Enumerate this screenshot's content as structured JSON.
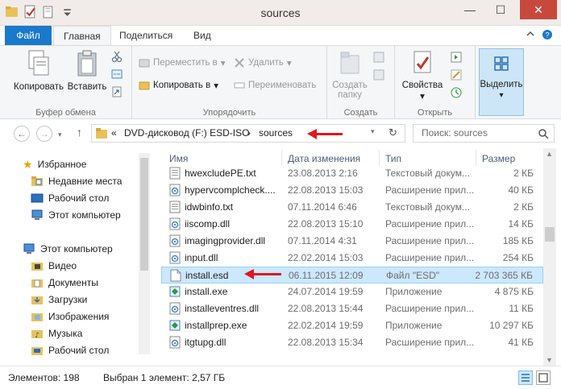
{
  "window": {
    "title": "sources",
    "minimize": "—",
    "maximize": "☐",
    "close": "✕"
  },
  "tabs": {
    "file": "Файл",
    "home": "Главная",
    "share": "Поделиться",
    "view": "Вид"
  },
  "ribbon": {
    "clipboard": {
      "label": "Буфер обмена",
      "copy": "Копировать",
      "paste": "Вставить"
    },
    "organize": {
      "label": "Упорядочить",
      "move_to": "Переместить в",
      "copy_to": "Копировать в",
      "delete": "Удалить",
      "rename": "Переименовать"
    },
    "new": {
      "label": "Создать",
      "new_folder_line1": "Создать",
      "new_folder_line2": "папку"
    },
    "open": {
      "label": "Открыть",
      "properties": "Свойства"
    },
    "select": {
      "label": "Выделить"
    }
  },
  "address": {
    "chevron": "«",
    "segment1": "DVD-дисковод (F:) ESD-ISO",
    "separator": "›",
    "segment2": "sources",
    "search_placeholder": "Поиск: sources"
  },
  "nav": {
    "favorites": "Избранное",
    "recent": "Недавние места",
    "desktop": "Рабочий стол",
    "this_pc_fav": "Этот компьютер",
    "this_pc": "Этот компьютер",
    "video": "Видео",
    "documents": "Документы",
    "downloads": "Загрузки",
    "images": "Изображения",
    "music": "Музыка",
    "desktop2": "Рабочий стол"
  },
  "columns": {
    "name": "Имя",
    "date": "Дата изменения",
    "type": "Тип",
    "size": "Размер"
  },
  "files": [
    {
      "name": "hwexcludePE.txt",
      "date": "23.08.2013 2:16",
      "type": "Текстовый докум...",
      "size": "2 КБ",
      "icon": "text-file-icon"
    },
    {
      "name": "hypervcomplcheck....",
      "date": "22.08.2013 15:03",
      "type": "Расширение прил...",
      "size": "40 КБ",
      "icon": "dll-file-icon"
    },
    {
      "name": "idwbinfo.txt",
      "date": "07.11.2014 6:46",
      "type": "Текстовый докум...",
      "size": "2 КБ",
      "icon": "text-file-icon"
    },
    {
      "name": "iiscomp.dll",
      "date": "22.08.2013 15:10",
      "type": "Расширение прил...",
      "size": "14 КБ",
      "icon": "dll-file-icon"
    },
    {
      "name": "imagingprovider.dll",
      "date": "07.11.2014 4:31",
      "type": "Расширение прил...",
      "size": "185 КБ",
      "icon": "dll-file-icon"
    },
    {
      "name": "input.dll",
      "date": "22.02.2014 15:03",
      "type": "Расширение прил...",
      "size": "254 КБ",
      "icon": "dll-file-icon"
    },
    {
      "name": "install.esd",
      "date": "06.11.2015 12:09",
      "type": "Файл \"ESD\"",
      "size": "2 703 365 КБ",
      "icon": "blank-file-icon"
    },
    {
      "name": "install.exe",
      "date": "24.07.2014 19:59",
      "type": "Приложение",
      "size": "4 875 КБ",
      "icon": "exe-file-icon"
    },
    {
      "name": "installeventres.dll",
      "date": "22.08.2013 15:44",
      "type": "Расширение прил...",
      "size": "11 КБ",
      "icon": "dll-file-icon"
    },
    {
      "name": "installprep.exe",
      "date": "22.02.2014 19:59",
      "type": "Приложение",
      "size": "10 297 КБ",
      "icon": "exe-file-icon"
    },
    {
      "name": "itgtupg.dll",
      "date": "22.08.2013 15:34",
      "type": "Расширение прил...",
      "size": "41 КБ",
      "icon": "dll-file-icon"
    }
  ],
  "selected_index": 6,
  "status": {
    "count": "Элементов: 198",
    "selected": "Выбран 1 элемент: 2,57 ГБ"
  },
  "colors": {
    "accent": "#1979ca",
    "selection": "#cce8ff",
    "close_button": "#c7493e",
    "annotation_arrow": "#e0191d"
  }
}
